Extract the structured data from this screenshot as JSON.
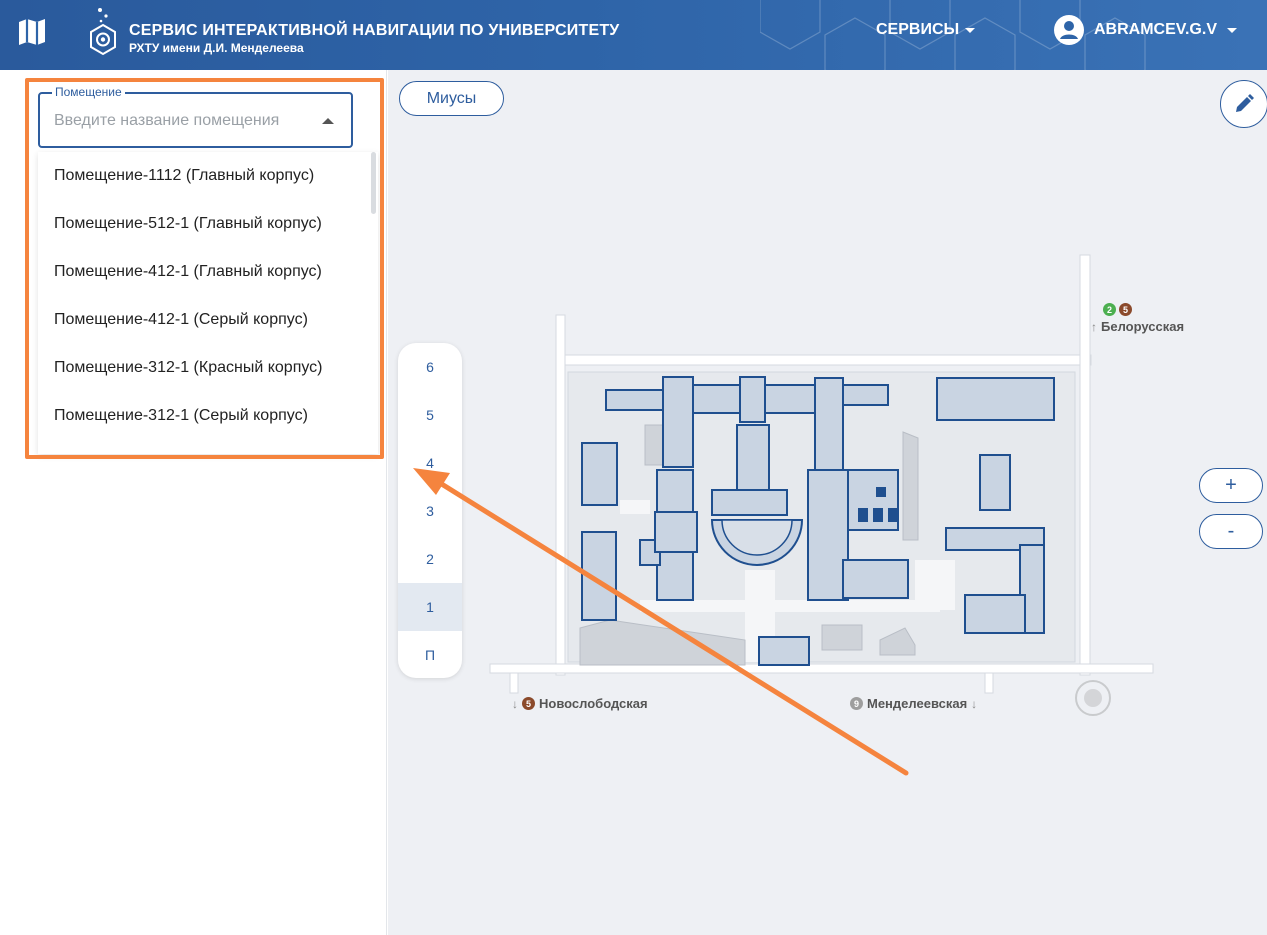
{
  "header": {
    "title": "СЕРВИС ИНТЕРАКТИВНОЙ НАВИГАЦИИ ПО УНИВЕРСИТЕТУ",
    "subtitle": "РХТУ имени Д.И. Менделеева",
    "services_label": "СЕРВИСЫ",
    "user_name": "ABRAMCEV.G.V",
    "colors": {
      "bar": "#2e64a8",
      "text": "#ffffff"
    }
  },
  "search": {
    "legend": "Помещение",
    "placeholder": "Введите название помещения",
    "value": ""
  },
  "dropdown": {
    "items": [
      "Помещение-1112 (Главный корпус)",
      "Помещение-512-1 (Главный корпус)",
      "Помещение-412-1 (Главный корпус)",
      "Помещение-412-1 (Серый корпус)",
      "Помещение-312-1 (Красный корпус)",
      "Помещение-312-1 (Серый корпус)"
    ]
  },
  "map": {
    "campus_button": "Миусы",
    "floors": [
      "6",
      "5",
      "4",
      "3",
      "2",
      "1",
      "П"
    ],
    "active_floor": "1",
    "zoom_in": "+",
    "zoom_out": "-",
    "metro": {
      "top": {
        "name": "Белорусская",
        "lines": [
          "2",
          "5"
        ]
      },
      "bottom_left": {
        "name": "Новослободская",
        "lines": [
          "5"
        ]
      },
      "bottom_right": {
        "name": "Менделеевская",
        "lines": [
          "9"
        ]
      }
    },
    "colors": {
      "building": "#1f4f8f",
      "room": "#c9d4e2",
      "ground": "#e7eaee",
      "accent": "#f5843e"
    }
  }
}
